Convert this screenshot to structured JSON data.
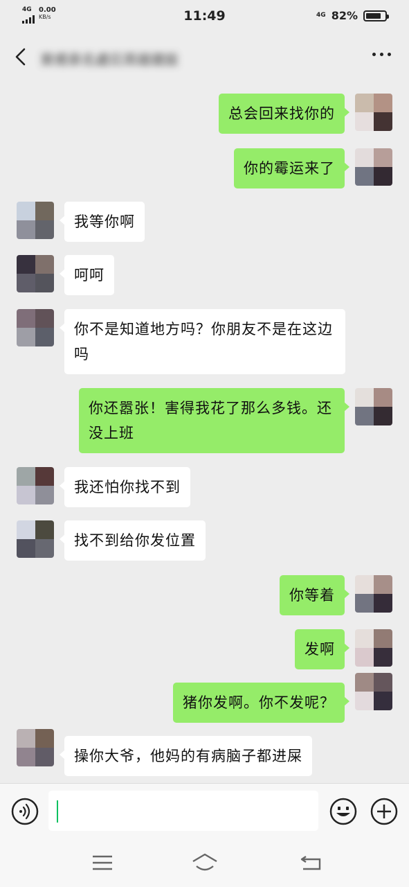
{
  "status_bar": {
    "network": "4G",
    "speed_value": "0.00",
    "speed_unit": "KB/s",
    "time": "11:49",
    "network_right": "4G",
    "battery_pct": "82%",
    "battery_level": 0.82
  },
  "header": {
    "title": "東甫泉名處巨英雄建設"
  },
  "messages": [
    {
      "side": "right",
      "text": "总会回来找你的"
    },
    {
      "side": "right",
      "text": "你的霉运来了"
    },
    {
      "side": "left",
      "text": "我等你啊"
    },
    {
      "side": "left",
      "text": "呵呵"
    },
    {
      "side": "left",
      "text": "你不是知道地方吗？你朋友不是在这边吗"
    },
    {
      "side": "right",
      "text": "你还嚣张！害得我花了那么多钱。还没上班"
    },
    {
      "side": "left",
      "text": "我还怕你找不到"
    },
    {
      "side": "left",
      "text": "找不到给你发位置"
    },
    {
      "side": "right",
      "text": "你等着"
    },
    {
      "side": "right",
      "text": "发啊"
    },
    {
      "side": "right",
      "text": "猪你发啊。你不发呢？"
    },
    {
      "side": "left",
      "text": "操你大爷，他妈的有病脑子都进屎"
    }
  ],
  "input": {
    "value": ""
  },
  "colors": {
    "background": "#ededed",
    "bubble_self": "#95ec69",
    "bubble_other": "#ffffff",
    "caret": "#07c160"
  },
  "icons": {
    "back": "back-arrow-icon",
    "more": "more-dots-icon",
    "voice": "voice-icon",
    "emoji": "emoji-icon",
    "plus": "plus-icon",
    "menu": "menu-icon",
    "home": "home-icon",
    "return": "return-icon"
  }
}
